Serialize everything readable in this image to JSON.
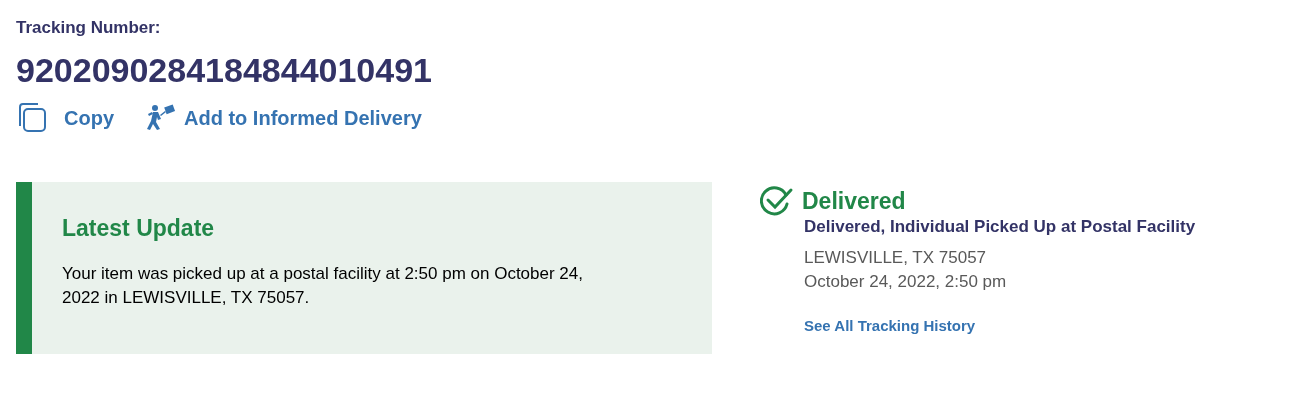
{
  "tracking_label": "Tracking Number:",
  "tracking_number": "9202090284184844010491",
  "actions": [
    {
      "kind": "copy",
      "label": "Copy"
    },
    {
      "kind": "informed",
      "label": "Add to Informed Delivery"
    }
  ],
  "latest_update": {
    "title": "Latest Update",
    "text": "Your item was picked up at a postal facility at 2:50 pm on October 24, 2022 in LEWISVILLE, TX 75057."
  },
  "status": {
    "title": "Delivered",
    "detail": "Delivered, Individual Picked Up at Postal Facility",
    "location": "LEWISVILLE, TX 75057",
    "datetime": "October 24, 2022, 2:50 pm",
    "history_link": "See All Tracking History"
  }
}
